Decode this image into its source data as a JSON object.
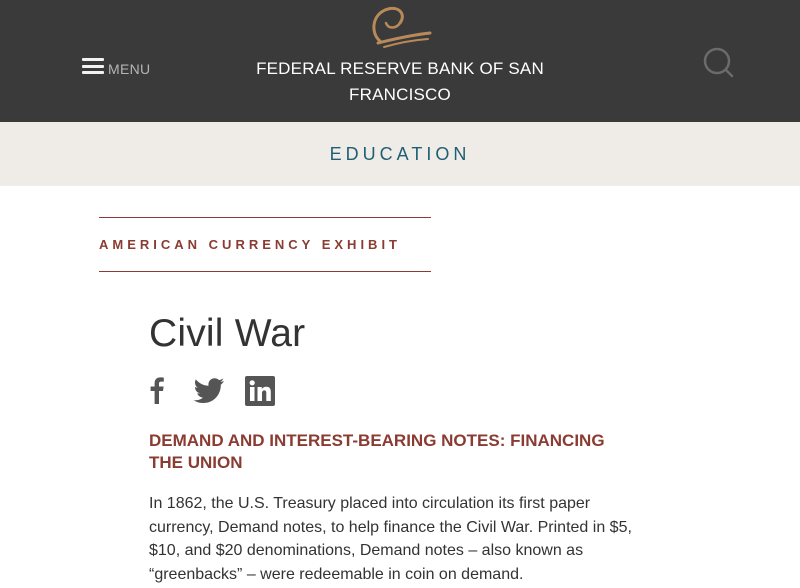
{
  "header": {
    "menu_label": "MENU",
    "bank_name": "FEDERAL RESERVE BANK OF SAN FRANCISCO",
    "background": "#3a3a3a",
    "logo_color": "#b88a5a"
  },
  "section": {
    "title": "EDUCATION",
    "background": "#efece8",
    "title_color": "#1f5f73"
  },
  "exhibit": {
    "label": "AMERICAN CURRENCY EXHIBIT",
    "accent": "#8a3b32"
  },
  "article": {
    "title": "Civil War",
    "share_icons": [
      "facebook-icon",
      "twitter-icon",
      "linkedin-icon"
    ],
    "subtitle": "DEMAND AND INTEREST-BEARING NOTES: FINANCING THE UNION",
    "body": "In 1862, the U.S. Treasury placed into circulation its first paper currency, Demand notes, to help finance the Civil War. Printed in $5, $10, and $20 denominations, Demand notes – also known as “greenbacks” – were redeemable in coin on demand."
  }
}
